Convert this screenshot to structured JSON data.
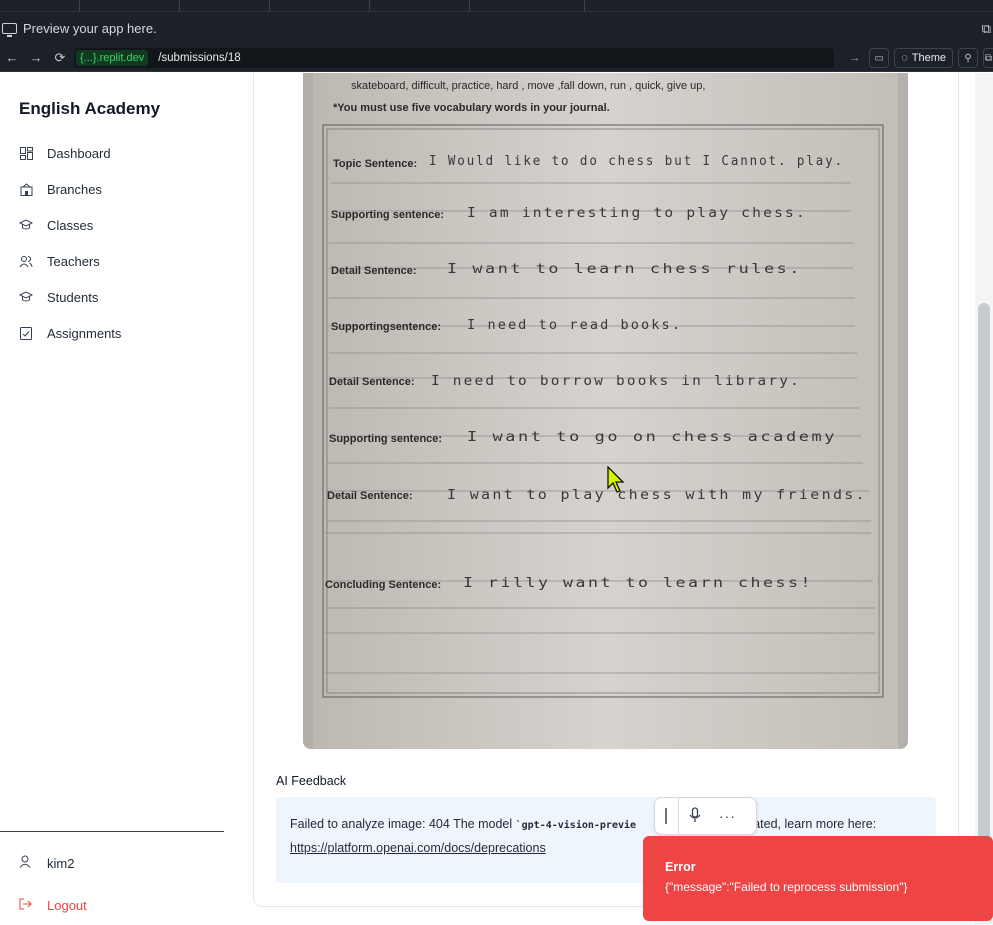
{
  "browser": {
    "preview_text": "Preview your app here.",
    "host": "{...}.replit.dev",
    "path": "/submissions/18",
    "theme_label": "Theme"
  },
  "sidebar": {
    "brand": "English Academy",
    "items": [
      {
        "label": "Dashboard",
        "icon": "dashboard-icon"
      },
      {
        "label": "Branches",
        "icon": "building-icon"
      },
      {
        "label": "Classes",
        "icon": "graduation-cap-icon"
      },
      {
        "label": "Teachers",
        "icon": "users-icon"
      },
      {
        "label": "Students",
        "icon": "graduation-cap-icon"
      },
      {
        "label": "Assignments",
        "icon": "clipboard-check-icon"
      }
    ],
    "user": "kim2",
    "logout": "Logout"
  },
  "submission": {
    "worksheet": {
      "word_bank": "skateboard, difficult, practice, hard , move ,fall down, run , quick, give up,",
      "instruction": "*You must use five vocabulary words in your journal.",
      "lines": [
        {
          "label": "Topic Sentence:",
          "text": "I Would like to do chess  but I Cannot. play."
        },
        {
          "label": "Supporting sentence:",
          "text": "I am interesting to play chess."
        },
        {
          "label": "Detail Sentence:",
          "text": "I want to learn chess rules."
        },
        {
          "label": "Supportingsentence:",
          "text": "I need to read books."
        },
        {
          "label": "Detail Sentence:",
          "text": "I need to borrow books in library."
        },
        {
          "label": "Supporting sentence:",
          "text": "I want to go on chess academy"
        },
        {
          "label": "Detail Sentence:",
          "text": "I want to play chess with my friends."
        },
        {
          "label": "Concluding Sentence:",
          "text": "I rilly want to learn chess!"
        }
      ]
    }
  },
  "feedback": {
    "title": "AI Feedback",
    "text_before": "Failed to analyze image: 404 The model ",
    "model": "`gpt-4-vision-previe",
    "text_after": "ecated, learn more here:",
    "link": "https://platform.openai.com/docs/deprecations"
  },
  "toast": {
    "title": "Error",
    "message": "{\"message\":\"Failed to reprocess submission\"}"
  },
  "colors": {
    "accent_error": "#ef4444",
    "feedback_bg": "#eef5fd",
    "chrome_bg": "#1c2127",
    "host_green": "#3fd06a"
  }
}
